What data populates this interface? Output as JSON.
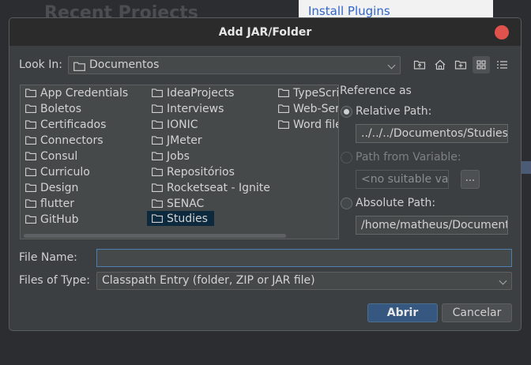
{
  "background": {
    "title": "Recent Projects",
    "plugins_link": "Install Plugins"
  },
  "dialog": {
    "title": "Add JAR/Folder",
    "look_in_label": "Look In:",
    "look_in_value": "Documentos",
    "files": [
      "App Credentials",
      "Boletos",
      "Certificados",
      "Connectors",
      "Consul",
      "Curriculo",
      "Design",
      "flutter",
      "GitHub",
      "IdeaProjects",
      "Interviews",
      "IONIC",
      "JMeter",
      "Jobs",
      "Repositórios",
      "Rocketseat - Ignite",
      "SENAC",
      "Studies",
      "TypeScri",
      "Web-Ser",
      "Word file"
    ],
    "selected_file": "Studies",
    "reference_as_label": "Reference as",
    "relative_path_label": "Relative Path:",
    "relative_path_value": "../../../Documentos/Studies",
    "path_from_variable_label": "Path from Variable:",
    "variable_placeholder": "<no suitable var",
    "browse_label": "...",
    "absolute_path_label": "Absolute Path:",
    "absolute_path_value": "/home/matheus/Documento",
    "file_name_label": "File Name:",
    "file_name_value": "",
    "files_of_type_label": "Files of Type:",
    "files_of_type_value": "Classpath Entry (folder, ZIP or JAR file)",
    "ok_label": "Abrir",
    "cancel_label": "Cancelar"
  }
}
